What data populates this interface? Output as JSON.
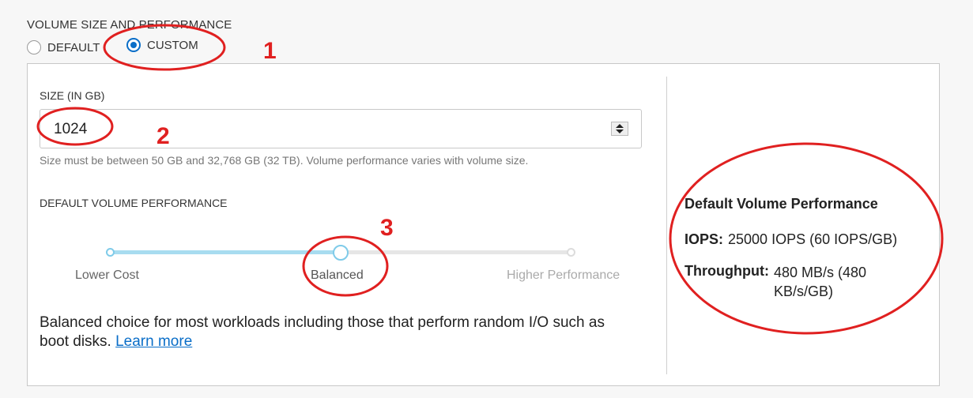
{
  "section_title": "VOLUME SIZE AND PERFORMANCE",
  "mode_options": [
    {
      "label": "DEFAULT",
      "selected": false
    },
    {
      "label": "CUSTOM",
      "selected": true
    }
  ],
  "size": {
    "label": "SIZE (IN GB)",
    "value": "1024",
    "help": "Size must be between 50 GB and 32,768 GB (32 TB). Volume performance varies with volume size."
  },
  "performance": {
    "label": "DEFAULT VOLUME PERFORMANCE",
    "stops": [
      "Lower Cost",
      "Balanced",
      "Higher Performance"
    ],
    "selected_stop_index": 1,
    "description": "Balanced choice for most workloads including those that perform random I/O such as boot disks.",
    "learn_more": "Learn more"
  },
  "summary": {
    "title": "Default Volume Performance",
    "iops_label": "IOPS:",
    "iops_value": "25000 IOPS (60 IOPS/GB)",
    "throughput_label": "Throughput:",
    "throughput_value": "480 MB/s (480 KB/s/GB)"
  },
  "annotations": [
    "1",
    "2",
    "3"
  ],
  "colors": {
    "accent": "#0a6ec8",
    "slider_active": "#a8dcf0",
    "annotation": "#e02020"
  }
}
